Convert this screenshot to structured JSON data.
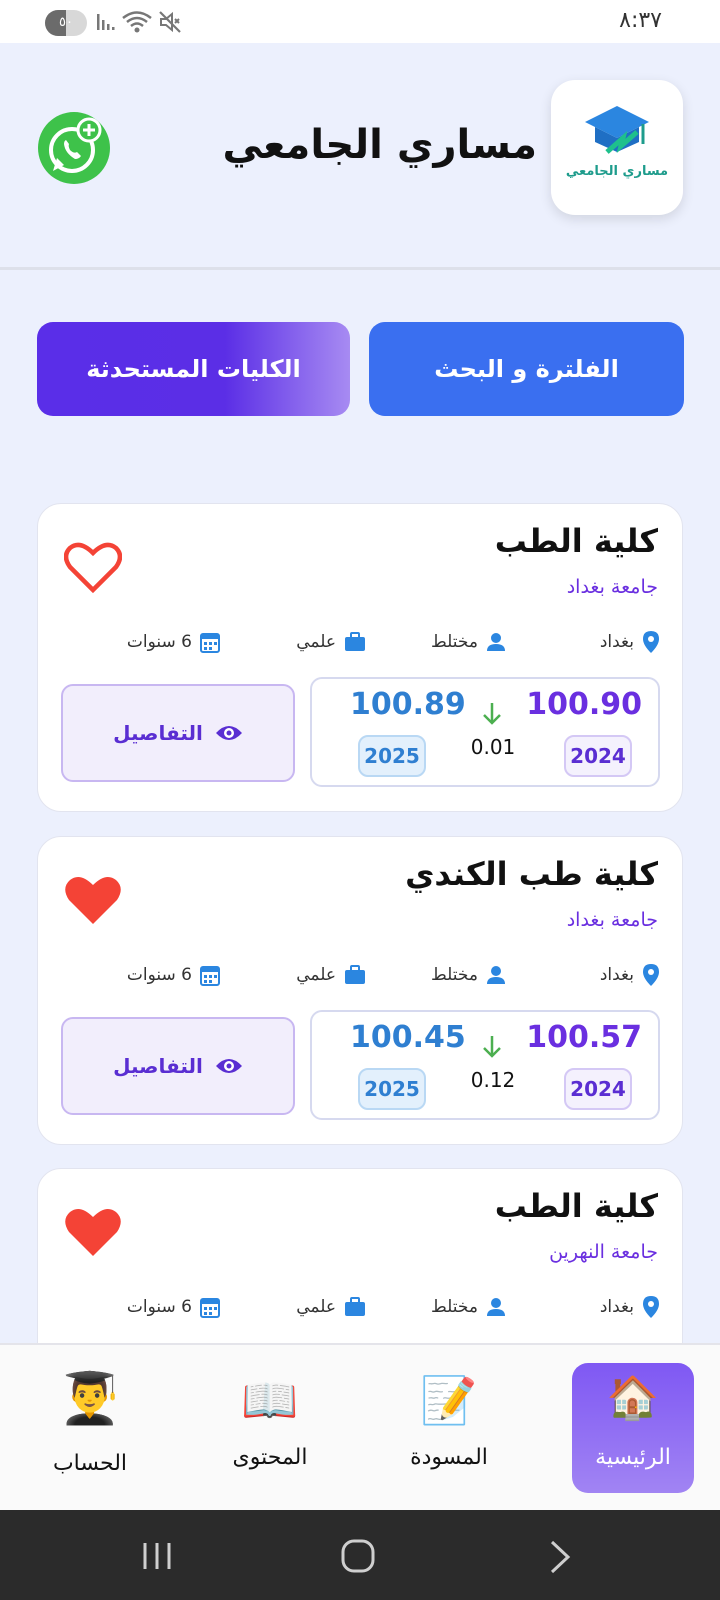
{
  "status_bar": {
    "time": "٨:٣٧",
    "battery": "٥٠",
    "battery_level": 0.5,
    "icons": [
      "signal-icon",
      "wifi-icon",
      "mute-icon"
    ]
  },
  "header": {
    "title": "مساري الجامعي",
    "logo_caption": "مساري الجامعي",
    "whatsapp_icon": "whatsapp-icon"
  },
  "actions": {
    "filter_label": "الفلترة و البحث",
    "new_colleges_label": "الكليات المستحدثة"
  },
  "cards": [
    {
      "title": "كلية الطب",
      "university": "جامعة بغداد",
      "favorite": false,
      "location": "بغداد",
      "gender": "مختلط",
      "branch": "علمي",
      "duration": "6 سنوات",
      "score_2024": "100.90",
      "score_2025": "100.89",
      "year_2024": "2024",
      "year_2025": "2025",
      "diff": "0.01",
      "details_label": "التفاصيل"
    },
    {
      "title": "كلية طب الكندي",
      "university": "جامعة بغداد",
      "favorite": true,
      "location": "بغداد",
      "gender": "مختلط",
      "branch": "علمي",
      "duration": "6 سنوات",
      "score_2024": "100.57",
      "score_2025": "100.45",
      "year_2024": "2024",
      "year_2025": "2025",
      "diff": "0.12",
      "details_label": "التفاصيل"
    },
    {
      "title": "كلية الطب",
      "university": "جامعة النهرين",
      "favorite": true,
      "location": "بغداد",
      "gender": "مختلط",
      "branch": "علمي",
      "duration": "6 سنوات"
    }
  ],
  "bottom_nav": [
    {
      "label": "الرئيسية",
      "icon": "🏠",
      "active": true
    },
    {
      "label": "المسودة",
      "icon": "📝",
      "active": false
    },
    {
      "label": "المحتوى",
      "icon": "📖",
      "active": false
    },
    {
      "label": "الحساب",
      "icon": "👨‍🎓",
      "active": false
    }
  ],
  "colors": {
    "primary_blue": "#3a6ff0",
    "purple": "#5a2ee8",
    "heart_red": "#f44336",
    "background": "#ecf0fd"
  }
}
